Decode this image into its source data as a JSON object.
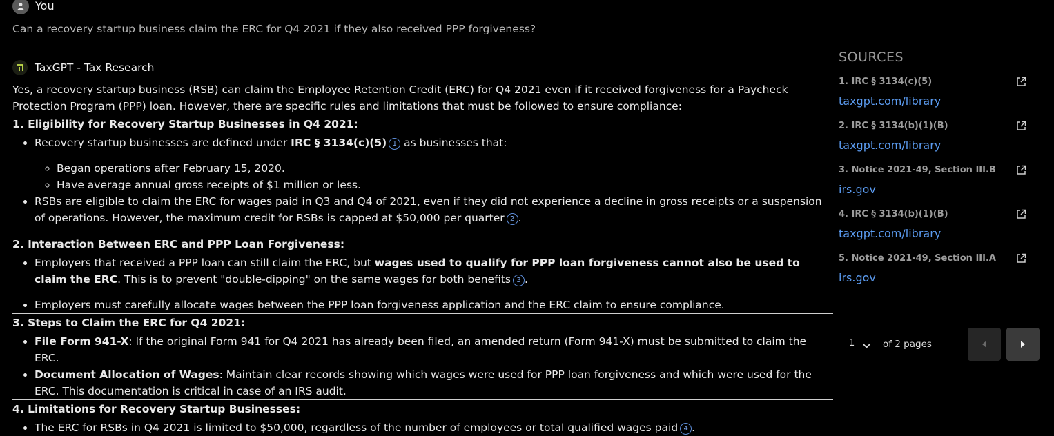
{
  "user": {
    "name": "You",
    "question": "Can a recovery startup business claim the ERC for Q4 2021 if they also received PPP forgiveness?"
  },
  "assistant": {
    "name": "TaxGPT - Tax Research",
    "intro": "Yes, a recovery startup business (RSB) can claim the Employee Retention Credit (ERC) for Q4 2021 even if it received forgiveness for a Paycheck Protection Program (PPP) loan. However, there are specific rules and limitations that must be followed to ensure compliance:",
    "s1": {
      "title": "1. Eligibility for Recovery Startup Businesses in Q4 2021:",
      "b1_pre": "Recovery startup businesses are defined under ",
      "b1_bold": "IRC § 3134(c)(5)",
      "b1_cite": "1",
      "b1_post": " as businesses that:",
      "sub1": "Began operations after February 15, 2020.",
      "sub2": "Have average annual gross receipts of $1 million or less.",
      "b2": "RSBs are eligible to claim the ERC for wages paid in Q3 and Q4 of 2021, even if they did not experience a decline in gross receipts or a suspension of operations. However, the maximum credit for RSBs is capped at $50,000 per quarter",
      "b2_cite": "2",
      "b2_end": "."
    },
    "s2": {
      "title": "2. Interaction Between ERC and PPP Loan Forgiveness:",
      "b1_pre": "Employers that received a PPP loan can still claim the ERC, but ",
      "b1_bold": "wages used to qualify for PPP loan forgiveness cannot also be used to claim the ERC",
      "b1_post": ". This is to prevent \"double-dipping\" on the same wages for both benefits",
      "b1_cite": "3",
      "b1_end": ".",
      "b2": "Employers must carefully allocate wages between the PPP loan forgiveness application and the ERC claim to ensure compliance."
    },
    "s3": {
      "title": "3. Steps to Claim the ERC for Q4 2021:",
      "b1_bold": "File Form 941-X",
      "b1_post": ": If the original Form 941 for Q4 2021 has already been filed, an amended return (Form 941-X) must be submitted to claim the ERC.",
      "b2_bold": "Document Allocation of Wages",
      "b2_post": ": Maintain clear records showing which wages were used for PPP loan forgiveness and which were used for the ERC. This documentation is critical in case of an IRS audit."
    },
    "s4": {
      "title": "4. Limitations for Recovery Startup Businesses:",
      "b1": "The ERC for RSBs in Q4 2021 is limited to $50,000, regardless of the number of employees or total qualified wages paid",
      "b1_cite": "4",
      "b1_end": "."
    }
  },
  "sources": {
    "title": "SOURCES",
    "items": [
      {
        "name": "1. IRC § 3134(c)(5)",
        "link": "taxgpt.com/library"
      },
      {
        "name": "2. IRC § 3134(b)(1)(B)",
        "link": "taxgpt.com/library"
      },
      {
        "name": "3. Notice 2021-49, Section III.B",
        "link": "irs.gov"
      },
      {
        "name": "4. IRC § 3134(b)(1)(B)",
        "link": "taxgpt.com/library"
      },
      {
        "name": "5. Notice 2021-49, Section III.A",
        "link": "irs.gov"
      }
    ]
  },
  "pager": {
    "current": "1",
    "of_label": "of 2 pages"
  },
  "colors": {
    "background": "#000000",
    "link": "#5b9bf0",
    "cite": "#7aa6ec"
  }
}
